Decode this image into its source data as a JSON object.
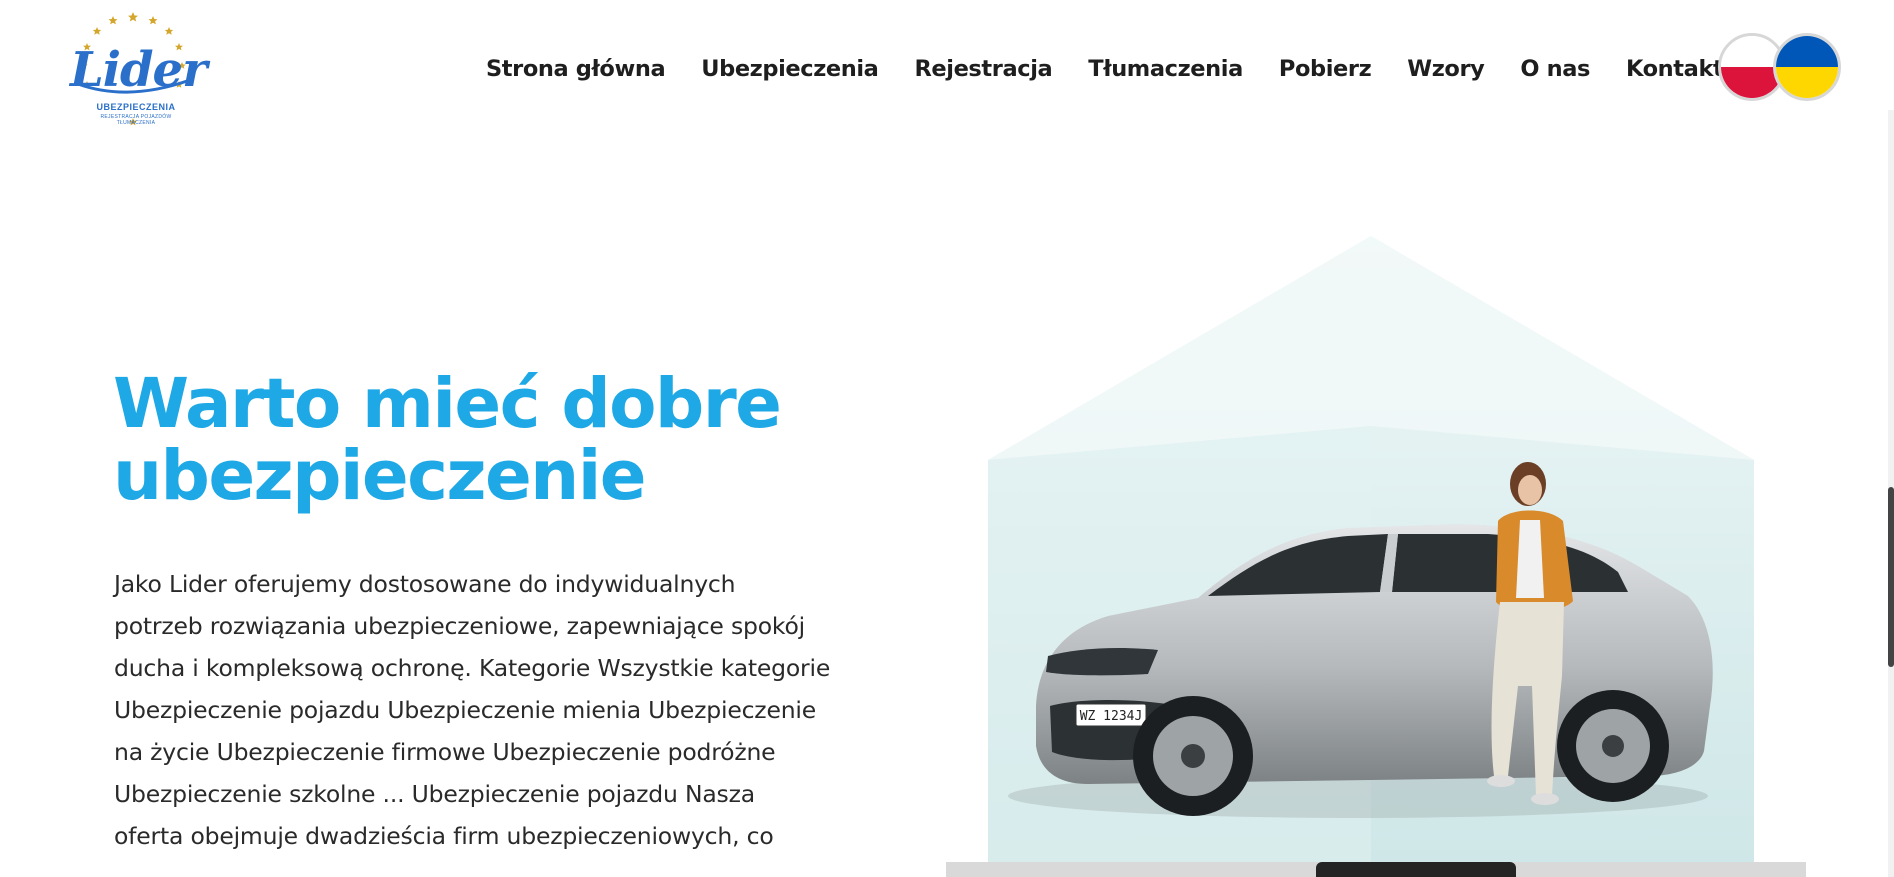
{
  "logo": {
    "brand": "Lider",
    "line1": "UBEZPIECZENIA",
    "line2": "REJESTRACJA POJAZDÓW",
    "line3": "TŁUMACZENIA"
  },
  "nav": {
    "items": [
      {
        "label": "Strona główna"
      },
      {
        "label": "Ubezpieczenia"
      },
      {
        "label": "Rejestracja"
      },
      {
        "label": "Tłumaczenia"
      },
      {
        "label": "Pobierz"
      },
      {
        "label": "Wzory"
      },
      {
        "label": "O nas"
      },
      {
        "label": "Kontakt"
      }
    ]
  },
  "languages": [
    {
      "icon": "poland-flag-icon",
      "colors": [
        "#ffffff",
        "#dc143c"
      ]
    },
    {
      "icon": "ukraine-flag-icon",
      "colors": [
        "#0057b7",
        "#ffd700"
      ]
    }
  ],
  "hero": {
    "title_line1": "Warto mieć dobre",
    "title_line2": "ubezpieczenie",
    "body_lines": [
      "Jako Lider oferujemy dostosowane do indywidualnych",
      "potrzeb rozwiązania ubezpieczeniowe, zapewniające spokój",
      "ducha i kompleksową ochronę. Kategorie Wszystkie kategorie",
      "Ubezpieczenie pojazdu Ubezpieczenie mienia Ubezpieczenie",
      "na życie Ubezpieczenie firmowe Ubezpieczenie podróżne",
      "Ubezpieczenie szkolne ... Ubezpieczenie pojazdu Nasza",
      "oferta obejmuje dwadzieścia firm ubezpieczeniowych, co"
    ],
    "image": {
      "subject": "car-with-woman-image",
      "plate": "WZ 1234J"
    }
  },
  "colors": {
    "accent": "#1ea9e6",
    "logo_blue": "#2a6fc9",
    "logo_gold": "#d4a72c",
    "text": "#2a2a2a",
    "house_glass": "#d5eced"
  }
}
